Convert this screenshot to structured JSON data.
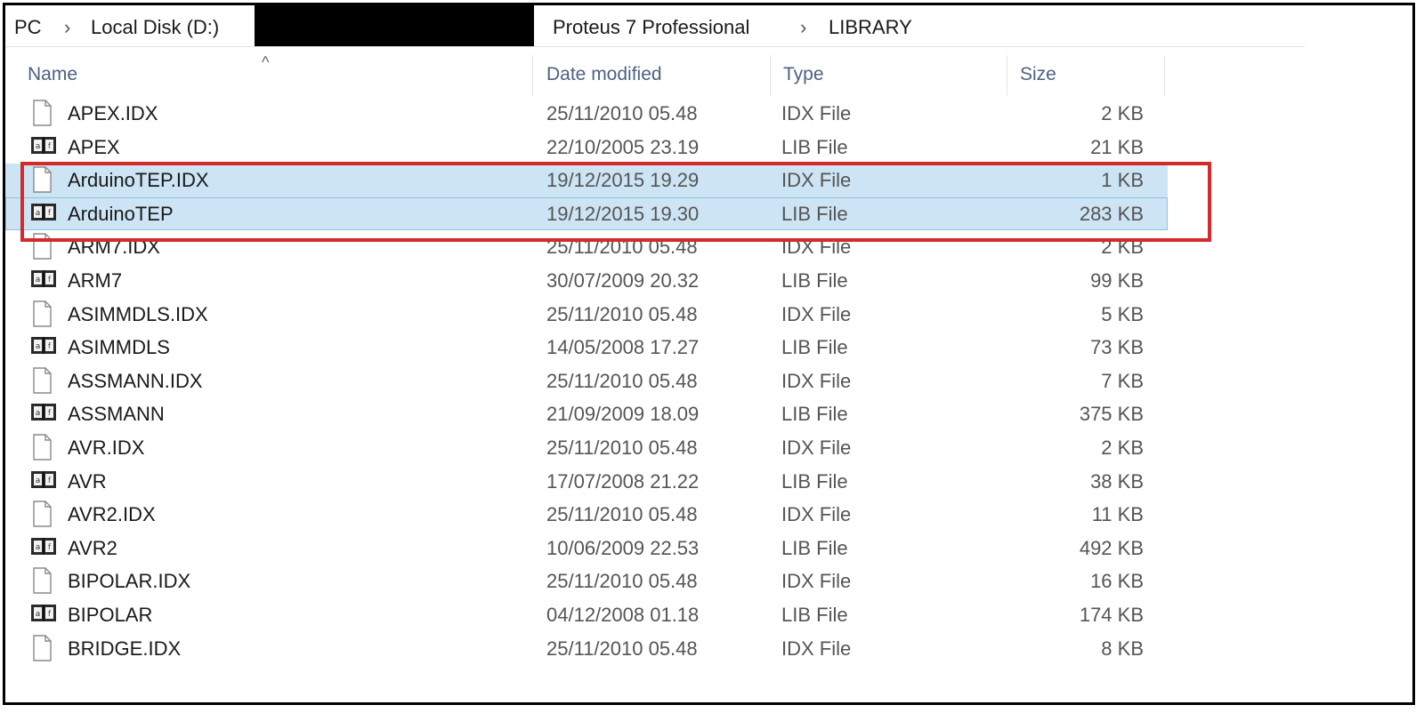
{
  "breadcrumb": {
    "items": [
      "PC",
      "Local Disk (D:)",
      "Proteus 7 Professional",
      "LIBRARY"
    ],
    "separator": "›"
  },
  "columns": {
    "name": "Name",
    "date": "Date modified",
    "type": "Type",
    "size": "Size"
  },
  "icons": {
    "idx": "blank-document-icon",
    "lib": "library-book-icon"
  },
  "colors": {
    "selection": "#cce4f3",
    "annotation": "#d42a2a",
    "header_text": "#4d6082"
  },
  "files": [
    {
      "name": "APEX.IDX",
      "date": "25/11/2010 05.48",
      "type": "IDX File",
      "size": "2 KB",
      "icon": "idx",
      "selected": false
    },
    {
      "name": "APEX",
      "date": "22/10/2005 23.19",
      "type": "LIB File",
      "size": "21 KB",
      "icon": "lib",
      "selected": false
    },
    {
      "name": "ArduinoTEP.IDX",
      "date": "19/12/2015 19.29",
      "type": "IDX File",
      "size": "1 KB",
      "icon": "idx",
      "selected": true
    },
    {
      "name": "ArduinoTEP",
      "date": "19/12/2015 19.30",
      "type": "LIB File",
      "size": "283 KB",
      "icon": "lib",
      "selected": true
    },
    {
      "name": "ARM7.IDX",
      "date": "25/11/2010 05.48",
      "type": "IDX File",
      "size": "2 KB",
      "icon": "idx",
      "selected": false
    },
    {
      "name": "ARM7",
      "date": "30/07/2009 20.32",
      "type": "LIB File",
      "size": "99 KB",
      "icon": "lib",
      "selected": false
    },
    {
      "name": "ASIMMDLS.IDX",
      "date": "25/11/2010 05.48",
      "type": "IDX File",
      "size": "5 KB",
      "icon": "idx",
      "selected": false
    },
    {
      "name": "ASIMMDLS",
      "date": "14/05/2008 17.27",
      "type": "LIB File",
      "size": "73 KB",
      "icon": "lib",
      "selected": false
    },
    {
      "name": "ASSMANN.IDX",
      "date": "25/11/2010 05.48",
      "type": "IDX File",
      "size": "7 KB",
      "icon": "idx",
      "selected": false
    },
    {
      "name": "ASSMANN",
      "date": "21/09/2009 18.09",
      "type": "LIB File",
      "size": "375 KB",
      "icon": "lib",
      "selected": false
    },
    {
      "name": "AVR.IDX",
      "date": "25/11/2010 05.48",
      "type": "IDX File",
      "size": "2 KB",
      "icon": "idx",
      "selected": false
    },
    {
      "name": "AVR",
      "date": "17/07/2008 21.22",
      "type": "LIB File",
      "size": "38 KB",
      "icon": "lib",
      "selected": false
    },
    {
      "name": "AVR2.IDX",
      "date": "25/11/2010 05.48",
      "type": "IDX File",
      "size": "11 KB",
      "icon": "idx",
      "selected": false
    },
    {
      "name": "AVR2",
      "date": "10/06/2009 22.53",
      "type": "LIB File",
      "size": "492 KB",
      "icon": "lib",
      "selected": false
    },
    {
      "name": "BIPOLAR.IDX",
      "date": "25/11/2010 05.48",
      "type": "IDX File",
      "size": "16 KB",
      "icon": "idx",
      "selected": false
    },
    {
      "name": "BIPOLAR",
      "date": "04/12/2008 01.18",
      "type": "LIB File",
      "size": "174 KB",
      "icon": "lib",
      "selected": false
    },
    {
      "name": "BRIDGE.IDX",
      "date": "25/11/2010 05.48",
      "type": "IDX File",
      "size": "8 KB",
      "icon": "idx",
      "selected": false
    }
  ]
}
